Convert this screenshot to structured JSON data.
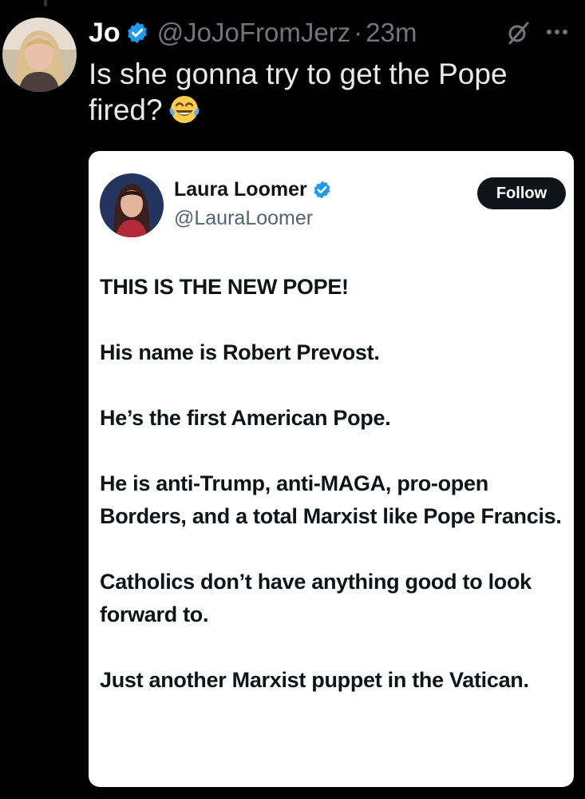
{
  "tweet": {
    "author_name": "Jo",
    "handle": "@JoJoFromJerz",
    "separator": "·",
    "time": "23m",
    "text": "Is she gonna try to get the Pope fired?",
    "emoji": "face-with-tears-of-joy",
    "verified": true
  },
  "quoted": {
    "author_name": "Laura Loomer",
    "handle": "@LauraLoomer",
    "verified": true,
    "follow_label": "Follow",
    "paragraphs": [
      "THIS IS THE NEW POPE!",
      "His name is Robert Prevost.",
      "He’s the first American Pope.",
      "He is anti-Trump, anti-MAGA, pro-open Borders, and a total Marxist like Pope Francis.",
      "Catholics don’t have anything good to look forward to.",
      "Just another Marxist puppet in the Vatican."
    ]
  },
  "icons": {
    "verified": "verified-badge-icon",
    "grok": "grok-icon",
    "more": "more-options-icon"
  },
  "colors": {
    "background": "#000000",
    "verified_blue": "#1d9bf0",
    "secondary_text": "#71767b",
    "card_background": "#ffffff",
    "follow_button": "#0f1419"
  }
}
